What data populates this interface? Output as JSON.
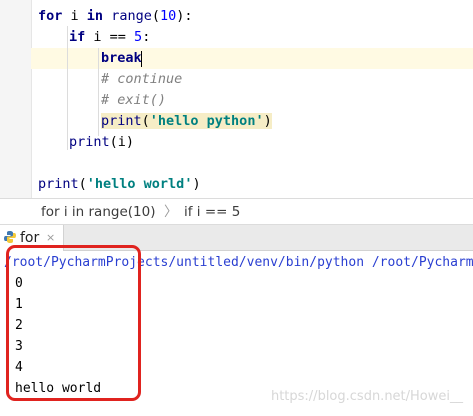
{
  "editor": {
    "lines": [
      {
        "tokens": [
          {
            "t": "for",
            "c": "kw"
          },
          {
            "t": " i ",
            "c": ""
          },
          {
            "t": "in",
            "c": "kw"
          },
          {
            "t": " ",
            "c": ""
          },
          {
            "t": "range",
            "c": "builtin"
          },
          {
            "t": "(",
            "c": ""
          },
          {
            "t": "10",
            "c": "num"
          },
          {
            "t": "):",
            "c": ""
          }
        ]
      },
      {
        "tokens": [
          {
            "t": "if",
            "c": "kw"
          },
          {
            "t": " i == ",
            "c": ""
          },
          {
            "t": "5",
            "c": "num"
          },
          {
            "t": ":",
            "c": ""
          }
        ]
      },
      {
        "tokens": [
          {
            "t": "break",
            "c": "kw"
          }
        ]
      },
      {
        "tokens": [
          {
            "t": "# continue",
            "c": "cmt"
          }
        ]
      },
      {
        "tokens": [
          {
            "t": "# exit()",
            "c": "cmt"
          }
        ]
      },
      {
        "tokens": [
          {
            "t": "print",
            "c": "builtin hl-print"
          },
          {
            "t": "(",
            "c": "hl-print"
          },
          {
            "t": "'hello python'",
            "c": "str hl-print"
          },
          {
            "t": ")",
            "c": "hl-print"
          }
        ]
      },
      {
        "tokens": [
          {
            "t": "print",
            "c": "builtin"
          },
          {
            "t": "(i)",
            "c": ""
          }
        ]
      },
      {
        "tokens": []
      },
      {
        "tokens": [
          {
            "t": "print",
            "c": "builtin"
          },
          {
            "t": "(",
            "c": ""
          },
          {
            "t": "'hello world'",
            "c": "str"
          },
          {
            "t": ")",
            "c": ""
          }
        ]
      }
    ]
  },
  "breadcrumb": {
    "items": [
      "for i in range(10)",
      "if i == 5"
    ],
    "separator": "〉"
  },
  "run_panel": {
    "tab_label": "for",
    "close_symbol": "×",
    "command": "/root/PycharmProjects/untitled/venv/bin/python /root/PycharmProjects/untitled/for.py",
    "output": [
      "0",
      "1",
      "2",
      "3",
      "4",
      "hello world"
    ]
  },
  "watermark": "https://blog.csdn.net/Howei__",
  "colors": {
    "keyword": "#000080",
    "number": "#0000ff",
    "string": "#008080",
    "comment": "#808080",
    "command": "#2a3fd1",
    "highlight_box": "#e0231f"
  }
}
